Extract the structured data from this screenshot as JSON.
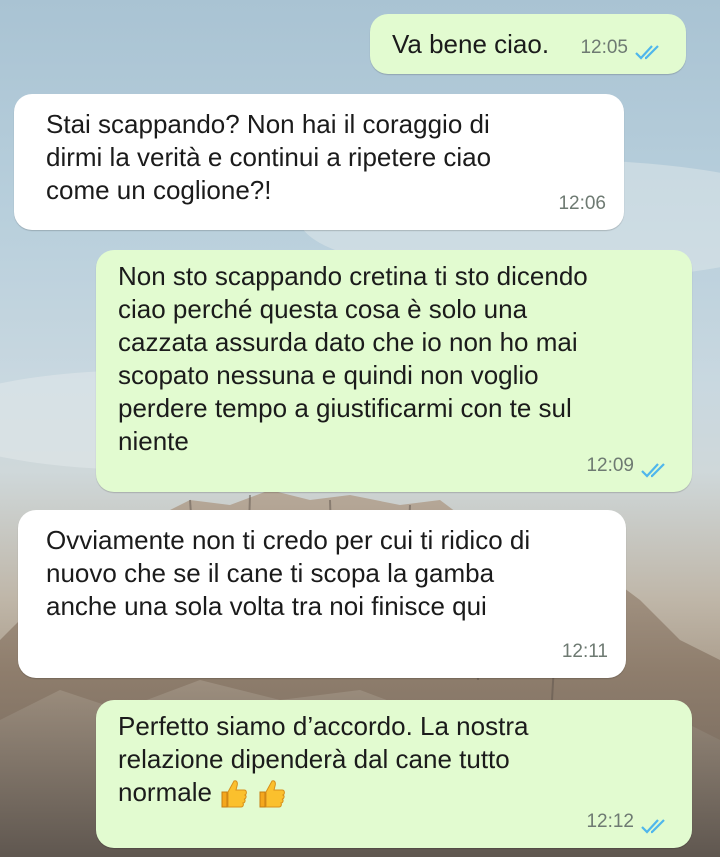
{
  "colors": {
    "outgoing_bubble": "#e2fbd0",
    "incoming_bubble": "#ffffff",
    "read_ticks": "#4fb6ec",
    "timestamp": "#6e7a72"
  },
  "messages": [
    {
      "direction": "outgoing",
      "text": "Va bene ciao.",
      "time": "12:05",
      "status": "read",
      "status_icon": "double-check-icon"
    },
    {
      "direction": "incoming",
      "text": "Stai scappando? Non hai il coraggio di\ndirmi la verità e continui a ripetere ciao\ncome un coglione?!",
      "time": "12:06"
    },
    {
      "direction": "outgoing",
      "text": "Non sto scappando cretina ti sto dicendo\nciao perché questa cosa è solo una\ncazzata assurda dato che io non ho mai\nscopato nessuna e quindi non voglio\nperdere tempo a giustificarmi con te sul\nniente",
      "time": "12:09",
      "status": "read",
      "status_icon": "double-check-icon"
    },
    {
      "direction": "incoming",
      "text": "Ovviamente non ti credo per cui ti ridico di\nnuovo che se il cane ti scopa la gamba\nanche una sola volta tra noi finisce qui",
      "time": "12:11"
    },
    {
      "direction": "outgoing",
      "text": "Perfetto siamo d’accordo. La nostra\nrelazione dipenderà dal cane tutto\nnormale",
      "emoji": [
        "thumbs-up-icon",
        "thumbs-up-icon"
      ],
      "time": "12:12",
      "status": "read",
      "status_icon": "double-check-icon"
    }
  ]
}
